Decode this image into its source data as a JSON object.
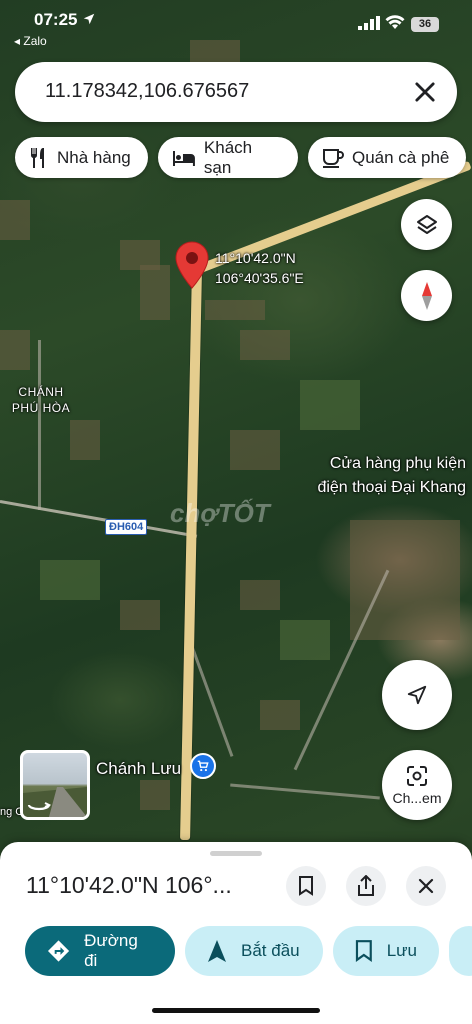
{
  "status_bar": {
    "time": "07:25",
    "back_app": "◂ Zalo",
    "battery": "36"
  },
  "search": {
    "value": "11.178342,106.676567"
  },
  "chips": [
    {
      "label": "Nhà hàng",
      "icon": "fork-knife-icon"
    },
    {
      "label": "Khách sạn",
      "icon": "bed-icon"
    },
    {
      "label": "Quán cà phê",
      "icon": "coffee-cup-icon"
    }
  ],
  "map": {
    "pin_coord_line1": "11°10'42.0\"N",
    "pin_coord_line2": "106°40'35.6\"E",
    "place_chanh_phu_hoa_1": "CHÁNH",
    "place_chanh_phu_hoa_2": "PHÚ HÒA",
    "shop_line1": "Cửa hàng phụ kiện",
    "shop_line2": "điện thoại Đại Khang",
    "road_badge": "ĐH604",
    "place_chanh_luu": "Chánh Lưu",
    "watermark": "chợTỐT",
    "chanh_luu_bottom_label": "Ch...em",
    "edge_fragment": "ng C"
  },
  "sheet": {
    "title": "11°10'42.0\"N 106°...",
    "actions": [
      {
        "label": "Đường đi",
        "icon": "directions-icon"
      },
      {
        "label": "Bắt đầu",
        "icon": "navigation-arrow-icon"
      },
      {
        "label": "Lưu",
        "icon": "bookmark-icon"
      }
    ]
  },
  "colors": {
    "accent_teal": "#0b6a7a",
    "chip_bg_secondary": "#c9eef6",
    "pin_red": "#e53935",
    "road": "#e5cd8e"
  }
}
